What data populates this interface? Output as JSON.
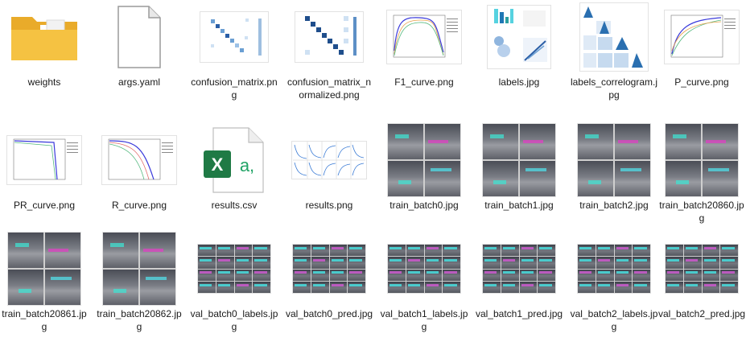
{
  "files": [
    {
      "name": "weights",
      "kind": "folder"
    },
    {
      "name": "args.yaml",
      "kind": "blank"
    },
    {
      "name": "confusion_matrix.png",
      "kind": "matrix"
    },
    {
      "name": "confusion_matrix_normalized.png",
      "kind": "matrix_norm"
    },
    {
      "name": "F1_curve.png",
      "kind": "curve_f1"
    },
    {
      "name": "labels.jpg",
      "kind": "labels"
    },
    {
      "name": "labels_correlogram.jpg",
      "kind": "correlogram"
    },
    {
      "name": "P_curve.png",
      "kind": "curve_p"
    },
    {
      "name": "PR_curve.png",
      "kind": "curve_pr"
    },
    {
      "name": "R_curve.png",
      "kind": "curve_r"
    },
    {
      "name": "results.csv",
      "kind": "excel"
    },
    {
      "name": "results.png",
      "kind": "results"
    },
    {
      "name": "train_batch0.jpg",
      "kind": "photo4"
    },
    {
      "name": "train_batch1.jpg",
      "kind": "photo4"
    },
    {
      "name": "train_batch2.jpg",
      "kind": "photo4"
    },
    {
      "name": "train_batch20860.jpg",
      "kind": "photo4"
    },
    {
      "name": "train_batch20861.jpg",
      "kind": "photo4"
    },
    {
      "name": "train_batch20862.jpg",
      "kind": "photo4"
    },
    {
      "name": "val_batch0_labels.jpg",
      "kind": "photo16"
    },
    {
      "name": "val_batch0_pred.jpg",
      "kind": "photo16"
    },
    {
      "name": "val_batch1_labels.jpg",
      "kind": "photo16"
    },
    {
      "name": "val_batch1_pred.jpg",
      "kind": "photo16"
    },
    {
      "name": "val_batch2_labels.jpg",
      "kind": "photo16"
    },
    {
      "name": "val_batch2_pred.jpg",
      "kind": "photo16"
    }
  ],
  "excel_icon": {
    "letter": "X",
    "suffix": "a,"
  },
  "colors": {
    "folder": "#f5c242",
    "folder_dark": "#e9ab2a",
    "excel_green": "#1f7a45",
    "excel_text": "#21a366",
    "matrix_blue": "#1f4e8c"
  }
}
